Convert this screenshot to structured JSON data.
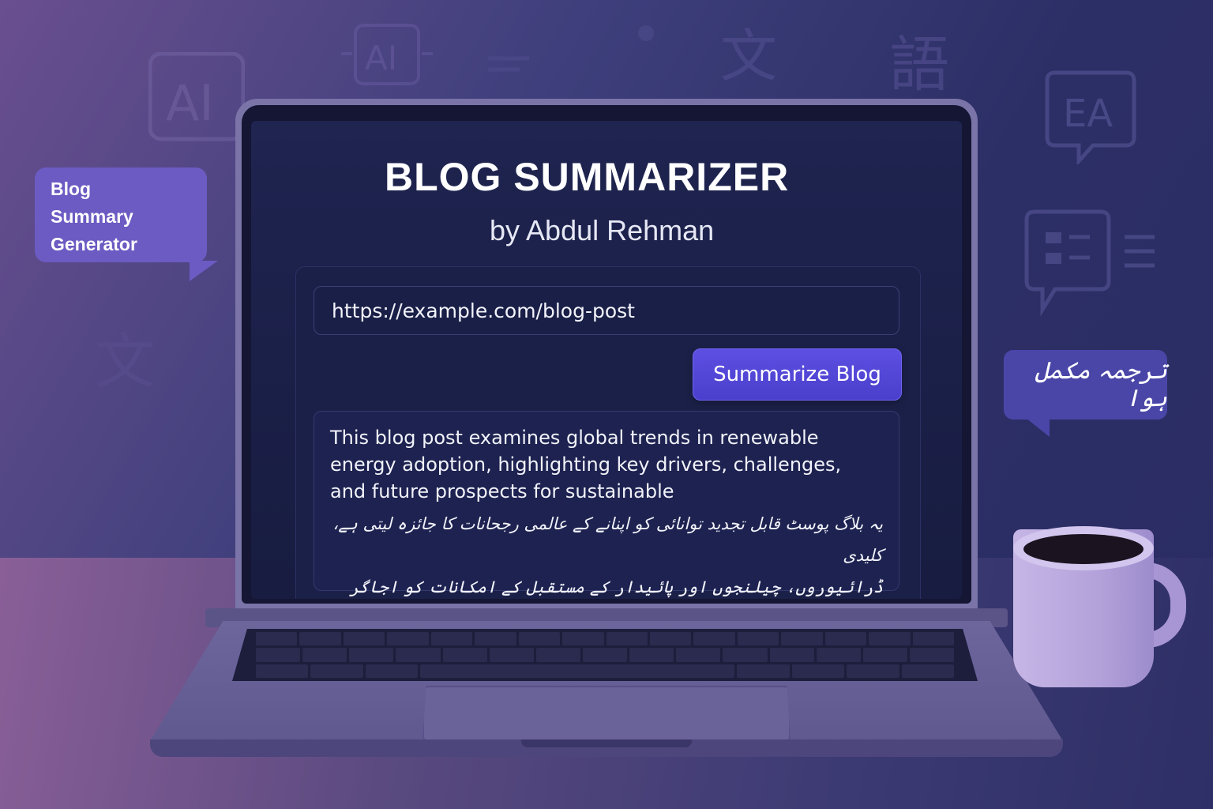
{
  "app": {
    "title": "BLOG SUMMARIZER",
    "subtitle": "by Abdul Rehman"
  },
  "form": {
    "url_value": "https://example.com/blog-post",
    "submit_label": "Summarize Blog"
  },
  "summary": {
    "english": "This blog post examines global trends in renewable energy adoption, highlighting key drivers, challenges, and future prospects for sustainable",
    "urdu_line1": "یہ بلاگ پوسٹ قابل تجدید توانائی کو اپنانے کے عالمی رجحانات کا جائزہ لیتی ہے، کلیدی",
    "urdu_line2": "ڈرائیوروں، چیلنجوں اور پائیدار کے مستقبل کے امکانات کو اجاگر کرتی ہے۔"
  },
  "bubbles": {
    "left_lines": [
      "Blog",
      "Summary",
      "Generator"
    ],
    "right_text": "ترجمہ مکمل ہوا"
  },
  "colors": {
    "accent": "#5d4fe2",
    "bubble_left": "#6b5bc2",
    "bubble_right": "#4a46a8",
    "screen_bg": "#1f2450"
  },
  "icons": [
    "ai-icon",
    "translate-icon",
    "chinese-char-icon",
    "text-lines-icon",
    "chat-translate-icon",
    "coffee-mug-icon"
  ],
  "background_labels": {
    "ai_large": "AI",
    "ai_small": "AI",
    "wen": "文",
    "yu": "語",
    "ea": "EA",
    "wen2": "文"
  }
}
